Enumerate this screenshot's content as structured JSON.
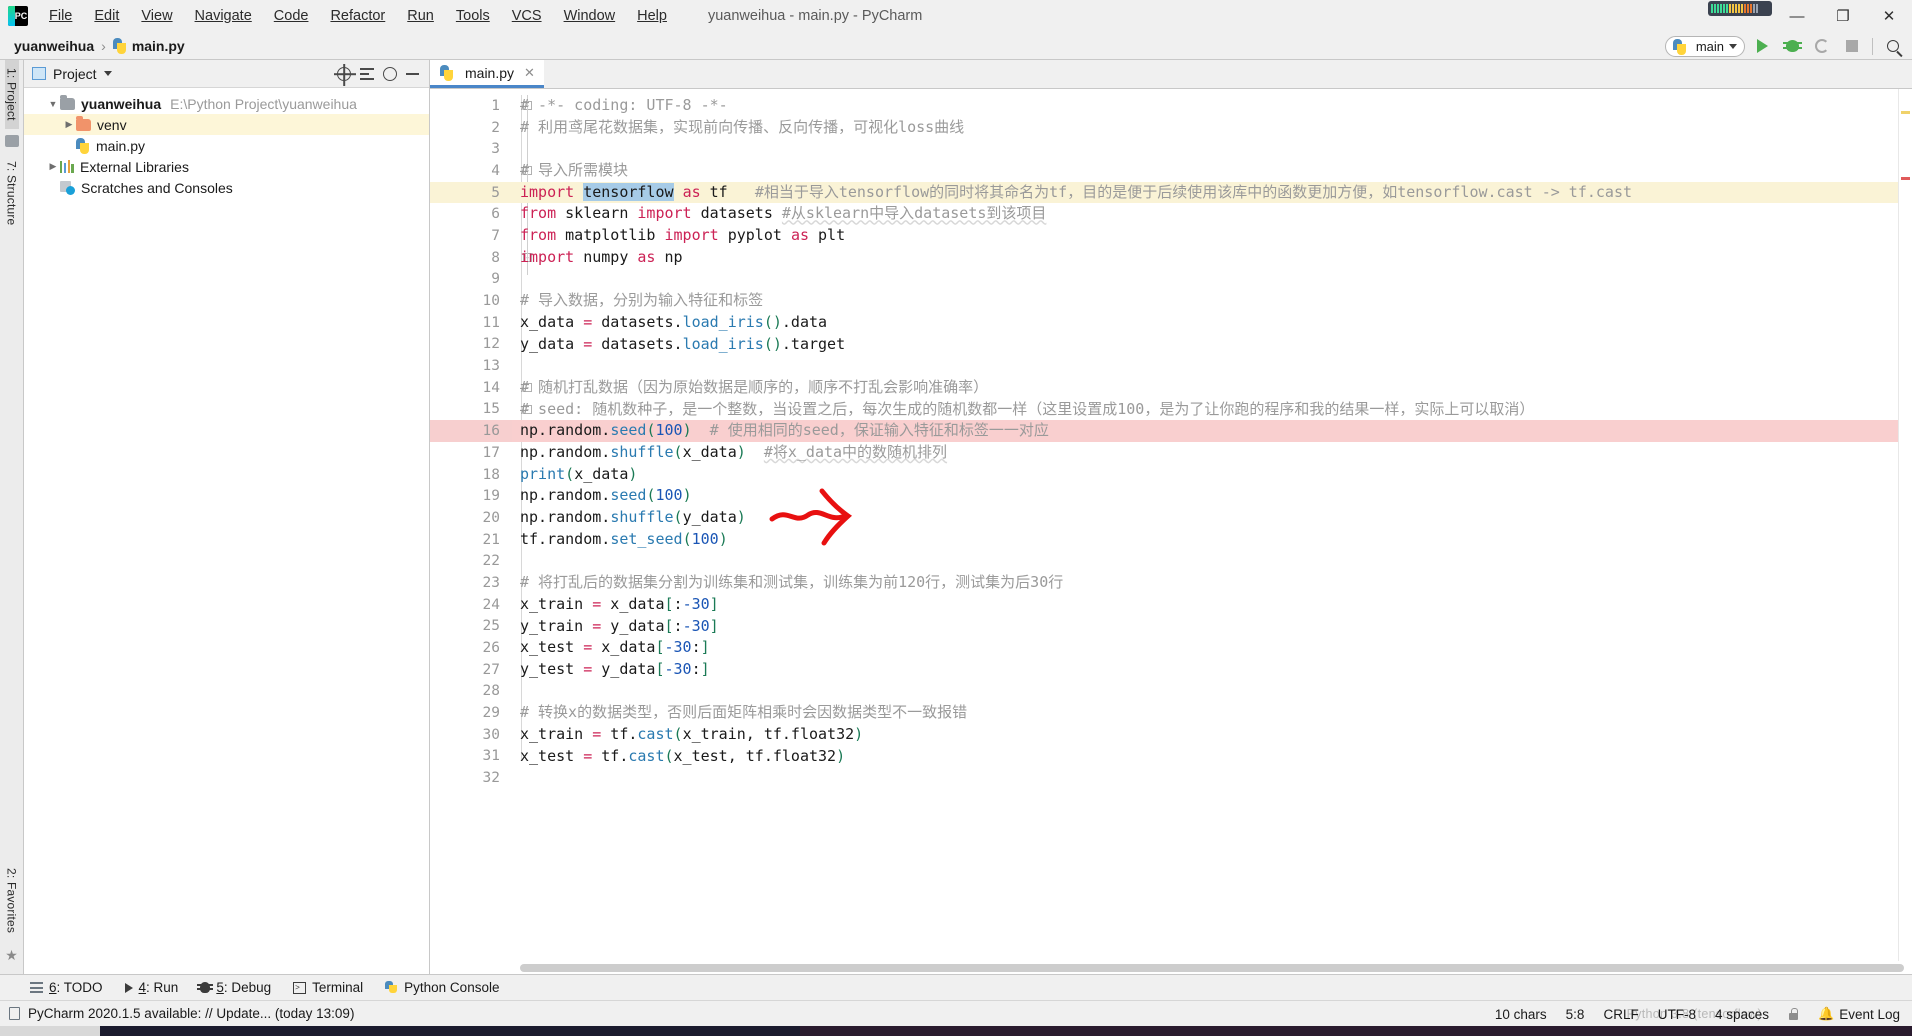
{
  "window": {
    "title": "yuanweihua - main.py - PyCharm",
    "logo_text": "PC",
    "minimize": "—",
    "maximize": "❐",
    "close": "✕"
  },
  "menu": {
    "items": [
      {
        "label": "File",
        "icon": "menu-file"
      },
      {
        "label": "Edit",
        "icon": "menu-edit"
      },
      {
        "label": "View",
        "icon": "menu-view"
      },
      {
        "label": "Navigate",
        "icon": "menu-navigate"
      },
      {
        "label": "Code",
        "icon": "menu-code"
      },
      {
        "label": "Refactor",
        "icon": "menu-refactor"
      },
      {
        "label": "Run",
        "icon": "menu-run"
      },
      {
        "label": "Tools",
        "icon": "menu-tools"
      },
      {
        "label": "VCS",
        "icon": "menu-vcs"
      },
      {
        "label": "Window",
        "icon": "menu-window"
      },
      {
        "label": "Help",
        "icon": "menu-help"
      }
    ]
  },
  "breadcrumb": {
    "project": "yuanweihua",
    "separator": "›",
    "file": "main.py"
  },
  "toolbar": {
    "run_config": "main",
    "run_label": "run-button",
    "debug_label": "debug-button",
    "coverage_label": "run-with-coverage-button",
    "stop_label": "stop-button",
    "search_label": "search-everywhere-button"
  },
  "stripe_left": {
    "project_tab": "1: Project",
    "structure_tab": "7: Structure",
    "favorites_tab": "2: Favorites"
  },
  "project_panel": {
    "title": "Project",
    "tools": [
      "select-opened-file",
      "collapse-all",
      "settings",
      "hide"
    ],
    "tree": [
      {
        "name": "yuanweihua",
        "path": "E:\\Python Project\\yuanweihua",
        "icon": "folder-icon",
        "arrow": "▼",
        "bold": true,
        "indent": 0,
        "selected": false
      },
      {
        "name": "venv",
        "path": "",
        "icon": "folder-orange-icon",
        "arrow": "▶",
        "bold": false,
        "indent": 1,
        "selected": true
      },
      {
        "name": "main.py",
        "path": "",
        "icon": "python-file-icon",
        "arrow": "",
        "bold": false,
        "indent": 1,
        "selected": false
      },
      {
        "name": "External Libraries",
        "path": "",
        "icon": "library-icon",
        "arrow": "▶",
        "bold": false,
        "indent": 0,
        "selected": false
      },
      {
        "name": "Scratches and Consoles",
        "path": "",
        "icon": "scratch-icon",
        "arrow": "",
        "bold": false,
        "indent": 0,
        "selected": false
      }
    ]
  },
  "editor": {
    "tab": {
      "label": "main.py",
      "close": "✕",
      "icon": "python-file-icon"
    },
    "selected_text": "tensorflow",
    "breakpoint_line": 16,
    "caret_line": 5,
    "lines": [
      {
        "n": 1,
        "fold": "⊖",
        "html": "<span class=\"cm\"># -*- coding: UTF-8 -*-</span>"
      },
      {
        "n": 2,
        "fold": "",
        "html": "<span class=\"cm\"># 利用鸢尾花数据集，实现前向传播、反向传播，可视化loss曲线</span>"
      },
      {
        "n": 3,
        "fold": "",
        "html": ""
      },
      {
        "n": 4,
        "fold": "⊖",
        "html": "<span class=\"cm\"># 导入所需模块</span>"
      },
      {
        "n": 5,
        "fold": "⊖",
        "hl": "y",
        "html": "<span class=\"kw\">import</span> <span class=\"caret-bar\"></span><span class=\"sel\">tensorflow</span> <span class=\"kw\">as</span> tf   <span class=\"cm\">#相当于导入tensorflow的同时将其命名为tf，目的是便于后续使用该库中的函数更加方便，如tensorflow.cast -&gt; tf.cast</span>"
      },
      {
        "n": 6,
        "fold": "",
        "html": "<span class=\"kw\">from</span> sklearn <span class=\"kw\">import</span> datasets <span class=\"cm-w\">#从sklearn中导入datasets到该项目</span>"
      },
      {
        "n": 7,
        "fold": "",
        "html": "<span class=\"kw\">from</span> matplotlib <span class=\"kw\">import</span> pyplot <span class=\"kw\">as</span> plt"
      },
      {
        "n": 8,
        "fold": "⊖",
        "html": "<span class=\"kw\">import</span> numpy <span class=\"kw\">as</span> np"
      },
      {
        "n": 9,
        "fold": "",
        "html": ""
      },
      {
        "n": 10,
        "fold": "",
        "html": "<span class=\"cm\"># 导入数据，分别为输入特征和标签</span>"
      },
      {
        "n": 11,
        "fold": "",
        "html": "x_data <span class=\"op\">=</span> datasets.<span class=\"fn\">load_iris</span><span class=\"par\">()</span>.data"
      },
      {
        "n": 12,
        "fold": "",
        "html": "y_data <span class=\"op\">=</span> datasets.<span class=\"fn\">load_iris</span><span class=\"par\">()</span>.target"
      },
      {
        "n": 13,
        "fold": "",
        "html": ""
      },
      {
        "n": 14,
        "fold": "⊖",
        "html": "<span class=\"cm\"># 随机打乱数据（因为原始数据是顺序的，顺序不打乱会影响准确率）</span>"
      },
      {
        "n": 15,
        "fold": "⊖",
        "html": "<span class=\"cm\"># seed: 随机数种子，是一个整数，当设置之后，每次生成的随机数都一样（这里设置成100，是为了让你跑的程序和我的结果一样，实际上可以取消）</span>"
      },
      {
        "n": 16,
        "fold": "",
        "hl": "r",
        "html": "np.random.<span class=\"fn\">seed</span><span class=\"par\">(</span><span class=\"num\">100</span><span class=\"par\">)</span>  <span class=\"cm\"># 使用相同的seed，保证输入特征和标签一一对应</span>"
      },
      {
        "n": 17,
        "fold": "",
        "html": "np.random.<span class=\"fn\">shuffle</span><span class=\"par\">(</span>x_data<span class=\"par\">)</span>  <span class=\"cm-w\">#将x_data中的数随机排列</span>"
      },
      {
        "n": 18,
        "fold": "",
        "html": "<span class=\"fn\">print</span><span class=\"par\">(</span>x_data<span class=\"par\">)</span>"
      },
      {
        "n": 19,
        "fold": "",
        "html": "np.random.<span class=\"fn\">seed</span><span class=\"par\">(</span><span class=\"num\">100</span><span class=\"par\">)</span>"
      },
      {
        "n": 20,
        "fold": "",
        "html": "np.random.<span class=\"fn\">shuffle</span><span class=\"par\">(</span>y_data<span class=\"par\">)</span>"
      },
      {
        "n": 21,
        "fold": "",
        "html": "tf.random.<span class=\"fn\">set_seed</span><span class=\"par\">(</span><span class=\"num\">100</span><span class=\"par\">)</span>"
      },
      {
        "n": 22,
        "fold": "",
        "html": ""
      },
      {
        "n": 23,
        "fold": "",
        "html": "<span class=\"cm\"># 将打乱后的数据集分割为训练集和测试集，训练集为前120行，测试集为后30行</span>"
      },
      {
        "n": 24,
        "fold": "",
        "html": "x_train <span class=\"op\">=</span> x_data<span class=\"par\">[</span>:<span class=\"num\">-30</span><span class=\"par\">]</span>"
      },
      {
        "n": 25,
        "fold": "",
        "html": "y_train <span class=\"op\">=</span> y_data<span class=\"par\">[</span>:<span class=\"num\">-30</span><span class=\"par\">]</span>"
      },
      {
        "n": 26,
        "fold": "",
        "html": "x_test <span class=\"op\">=</span> x_data<span class=\"par\">[</span><span class=\"num\">-30</span>:<span class=\"par\">]</span>"
      },
      {
        "n": 27,
        "fold": "",
        "html": "y_test <span class=\"op\">=</span> y_data<span class=\"par\">[</span><span class=\"num\">-30</span>:<span class=\"par\">]</span>"
      },
      {
        "n": 28,
        "fold": "",
        "html": ""
      },
      {
        "n": 29,
        "fold": "",
        "html": "<span class=\"cm\"># 转换x的数据类型，否则后面矩阵相乘时会因数据类型不一致报错</span>"
      },
      {
        "n": 30,
        "fold": "",
        "html": "x_train <span class=\"op\">=</span> tf.<span class=\"fn\">cast</span><span class=\"par\">(</span>x_train, tf.float32<span class=\"par\">)</span>"
      },
      {
        "n": 31,
        "fold": "",
        "html": "x_test <span class=\"op\">=</span> tf.<span class=\"fn\">cast</span><span class=\"par\">(</span>x_test, tf.float32<span class=\"par\">)</span>"
      },
      {
        "n": 32,
        "fold": "",
        "html": ""
      }
    ]
  },
  "toolwindows": {
    "items": [
      {
        "num": "6",
        "label": ": TODO",
        "icon": "todo-icon"
      },
      {
        "num": "4",
        "label": ": Run",
        "icon": "run-icon"
      },
      {
        "num": "5",
        "label": ": Debug",
        "icon": "debug-icon"
      },
      {
        "num": "",
        "label": "Terminal",
        "icon": "terminal-icon"
      },
      {
        "num": "",
        "label": "Python Console",
        "icon": "python-console-icon"
      }
    ]
  },
  "statusbar": {
    "message": "PyCharm 2020.1.5 available: // Update... (today 13:09)",
    "chars": "10 chars",
    "caret_pos": "5:8",
    "line_sep": "CRLF",
    "encoding": "UTF-8",
    "indent": "4 spaces",
    "lock_icon": "lock-icon",
    "event_log": "Event Log",
    "watermark": "Python 3.8 (tensorflow)"
  },
  "colors": {
    "accent": "#4a86c8",
    "selection": "#a6cbe7",
    "caret_row": "#faf3d6",
    "breakpoint_row": "#f9cfcf",
    "breakpoint_dot": "#e05a5a",
    "annotation": "#e81010",
    "keyword": "#cc2255",
    "function": "#2a7ab0",
    "number": "#1a55b5",
    "comment": "#9a9a9a"
  }
}
